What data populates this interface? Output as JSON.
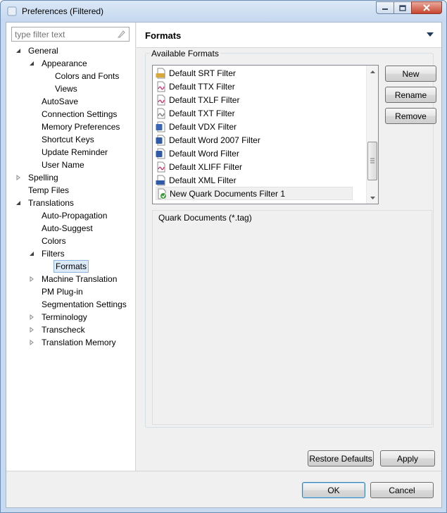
{
  "window": {
    "title": "Preferences (Filtered)"
  },
  "filter": {
    "placeholder": "type filter text"
  },
  "tree": [
    {
      "label": "General",
      "indent": 0,
      "arrow": "expanded"
    },
    {
      "label": "Appearance",
      "indent": 1,
      "arrow": "expanded"
    },
    {
      "label": "Colors and Fonts",
      "indent": 2,
      "arrow": "none"
    },
    {
      "label": "Views",
      "indent": 2,
      "arrow": "none"
    },
    {
      "label": "AutoSave",
      "indent": 1,
      "arrow": "none"
    },
    {
      "label": "Connection Settings",
      "indent": 1,
      "arrow": "none"
    },
    {
      "label": "Memory Preferences",
      "indent": 1,
      "arrow": "none"
    },
    {
      "label": "Shortcut Keys",
      "indent": 1,
      "arrow": "none"
    },
    {
      "label": "Update Reminder",
      "indent": 1,
      "arrow": "none"
    },
    {
      "label": "User Name",
      "indent": 1,
      "arrow": "none"
    },
    {
      "label": "Spelling",
      "indent": 0,
      "arrow": "collapsed"
    },
    {
      "label": "Temp Files",
      "indent": 0,
      "arrow": "none"
    },
    {
      "label": "Translations",
      "indent": 0,
      "arrow": "expanded"
    },
    {
      "label": "Auto-Propagation",
      "indent": 1,
      "arrow": "none"
    },
    {
      "label": "Auto-Suggest",
      "indent": 1,
      "arrow": "none"
    },
    {
      "label": "Colors",
      "indent": 1,
      "arrow": "none"
    },
    {
      "label": "Filters",
      "indent": 1,
      "arrow": "expanded"
    },
    {
      "label": "Formats",
      "indent": 2,
      "arrow": "none",
      "selected": true
    },
    {
      "label": "Machine Translation",
      "indent": 1,
      "arrow": "collapsed"
    },
    {
      "label": "PM Plug-in",
      "indent": 1,
      "arrow": "none"
    },
    {
      "label": "Segmentation Settings",
      "indent": 1,
      "arrow": "none"
    },
    {
      "label": "Terminology",
      "indent": 1,
      "arrow": "collapsed"
    },
    {
      "label": "Transcheck",
      "indent": 1,
      "arrow": "collapsed"
    },
    {
      "label": "Translation Memory",
      "indent": 1,
      "arrow": "collapsed"
    }
  ],
  "page": {
    "title": "Formats"
  },
  "formats": {
    "group_label": "Available Formats",
    "items": [
      {
        "label": "Default SRT Filter",
        "icon": "srt-file-icon"
      },
      {
        "label": "Default TTX Filter",
        "icon": "ttx-file-icon"
      },
      {
        "label": "Default TXLF Filter",
        "icon": "txlf-file-icon"
      },
      {
        "label": "Default TXT Filter",
        "icon": "txt-file-icon"
      },
      {
        "label": "Default VDX Filter",
        "icon": "vdx-file-icon"
      },
      {
        "label": "Default Word 2007 Filter",
        "icon": "word2007-file-icon"
      },
      {
        "label": "Default Word Filter",
        "icon": "word-file-icon"
      },
      {
        "label": "Default XLIFF Filter",
        "icon": "xliff-file-icon"
      },
      {
        "label": "Default XML Filter",
        "icon": "xml-file-icon"
      },
      {
        "label": "New Quark Documents Filter 1",
        "icon": "new-filter-icon",
        "selected": true
      }
    ],
    "description": "Quark Documents (*.tag)",
    "scroll_position": 0.85
  },
  "buttons": {
    "new": "New",
    "rename": "Rename",
    "remove": "Remove",
    "restore_defaults": "Restore Defaults",
    "apply": "Apply",
    "ok": "OK",
    "cancel": "Cancel"
  },
  "colors": {
    "selection_bg": "#dceaf8",
    "selection_border": "#8eb4de",
    "title_bar": "#c5d8ef"
  }
}
